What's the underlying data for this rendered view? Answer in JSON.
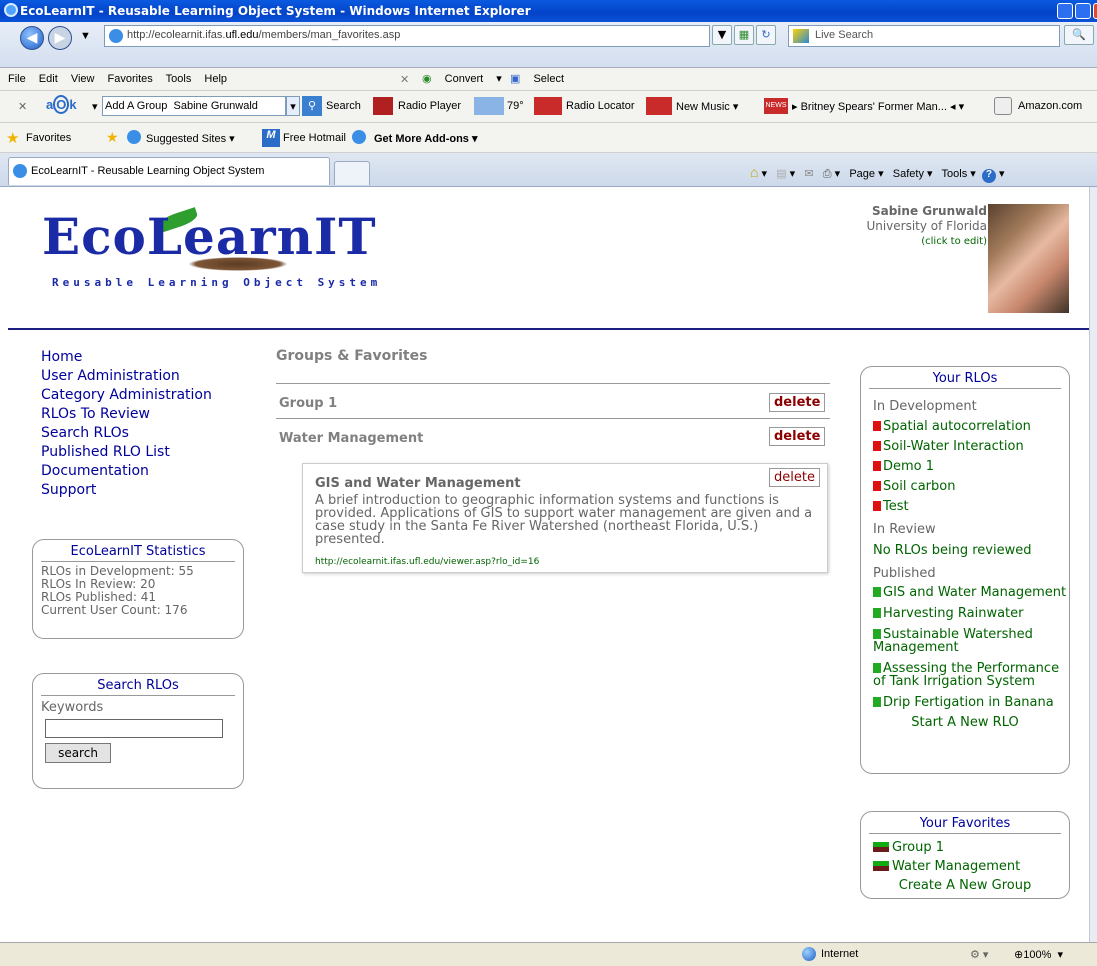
{
  "window": {
    "title": "EcoLearnIT - Reusable Learning Object System - Windows Internet Explorer"
  },
  "address": {
    "prefix": "http://ecolearnit.ifas.",
    "host": "ufl.edu",
    "path": "/members/man_favorites.asp"
  },
  "search": {
    "placeholder": "Live Search"
  },
  "menu": [
    "File",
    "Edit",
    "View",
    "Favorites",
    "Tools",
    "Help"
  ],
  "menu_extra": {
    "convert": "Convert",
    "select": "Select"
  },
  "toolbar": {
    "group_label": "Add A Group",
    "user": "Sabine Grunwald",
    "search": "Search",
    "radio_player": "Radio Player",
    "temp": "79°",
    "radio_locator": "Radio Locator",
    "new_music": "New Music",
    "news": "Britney Spears' Former Man...",
    "amazon": "Amazon.com"
  },
  "favbar": {
    "favorites": "Favorites",
    "suggested": "Suggested Sites",
    "hotmail": "Free Hotmail",
    "addons": "Get More Add-ons"
  },
  "tab": {
    "title": "EcoLearnIT - Reusable Learning Object System"
  },
  "cmdbar": {
    "page": "Page",
    "safety": "Safety",
    "tools": "Tools"
  },
  "header": {
    "logo": "EcoLearnIT",
    "tagline": "Reusable Learning Object System",
    "user_name": "Sabine Grunwald",
    "user_org": "University of Florida",
    "edit": "(click to edit)"
  },
  "nav": [
    "Home",
    "User Administration",
    "Category Administration",
    "RLOs To Review",
    "Search RLOs",
    "Published RLO List",
    "Documentation",
    "Support"
  ],
  "stats": {
    "title": "EcoLearnIT Statistics",
    "lines": [
      "RLOs in Development: 55",
      "RLOs In Review: 20",
      "RLOs Published: 41",
      "Current User Count: 176"
    ]
  },
  "search_box": {
    "title": "Search RLOs",
    "label": "Keywords",
    "button": "search"
  },
  "main": {
    "title": "Groups & Favorites",
    "groups": [
      "Group 1",
      "Water Management"
    ],
    "delete": "delete",
    "card": {
      "title": "GIS and Water Management",
      "desc": "A brief introduction to geographic information systems and functions is provided. Applications of GIS to support water management are given and a case study in the Santa Fe River Watershed (northeast Florida, U.S.) presented.",
      "url": "http://ecolearnit.ifas.ufl.edu/viewer.asp?rlo_id=16"
    }
  },
  "rlos": {
    "title": "Your RLOs",
    "dev_label": "In Development",
    "dev": [
      "Spatial autocorrelation",
      "Soil-Water Interaction",
      "Demo 1",
      "Soil carbon",
      "Test"
    ],
    "review_label": "In Review",
    "review_none": "No RLOs being reviewed",
    "pub_label": "Published",
    "pub": [
      "GIS and Water Management",
      "Harvesting Rainwater",
      "Sustainable Watershed Management",
      "Assessing the Performance of Tank Irrigation System",
      "Drip Fertigation in Banana"
    ],
    "new": "Start A New RLO"
  },
  "favs": {
    "title": "Your Favorites",
    "items": [
      "Group 1",
      "Water Management"
    ],
    "new": "Create A New Group"
  },
  "status": {
    "zone": "Internet",
    "zoom": "100%"
  }
}
